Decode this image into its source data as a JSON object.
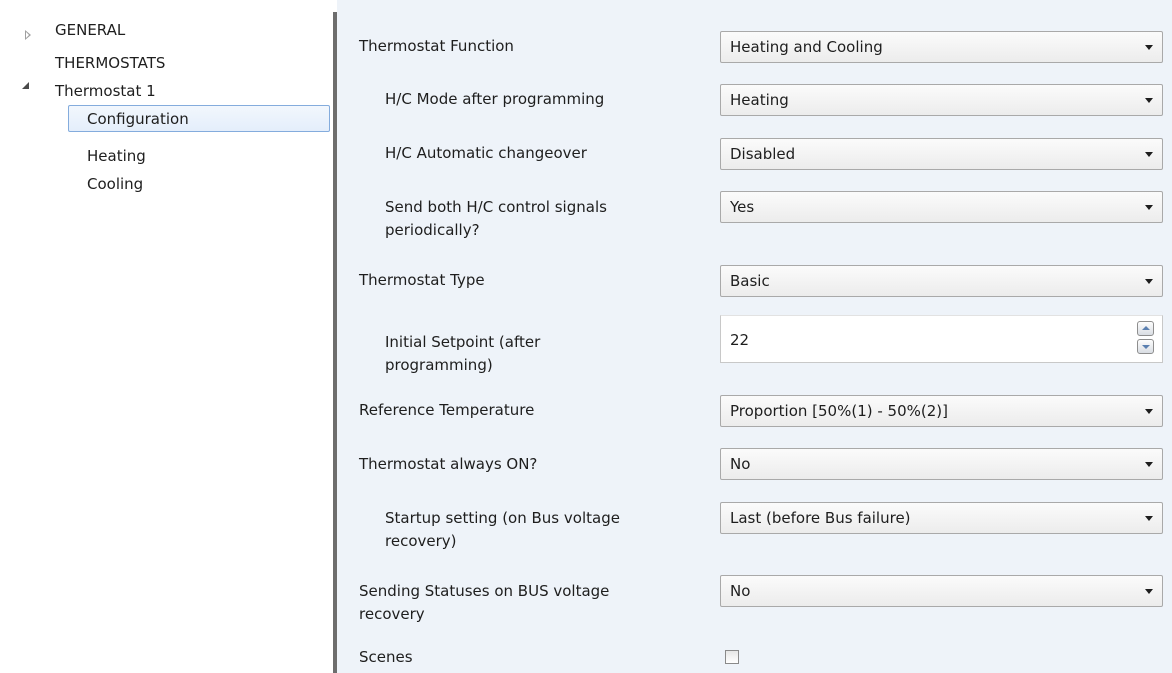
{
  "sidebar": {
    "items": [
      {
        "label": "GENERAL"
      },
      {
        "label": "THERMOSTATS"
      },
      {
        "label": "Thermostat 1"
      },
      {
        "label": "Configuration"
      },
      {
        "label": "Heating"
      },
      {
        "label": "Cooling"
      }
    ],
    "selected_color": "#84acdd"
  },
  "params": {
    "thermostat_function": {
      "label": "Thermostat Function",
      "value": "Heating and Cooling"
    },
    "hc_mode": {
      "label": "H/C Mode after programming",
      "value": "Heating"
    },
    "hc_auto": {
      "label": "H/C Automatic changeover",
      "value": "Disabled"
    },
    "send_both": {
      "label": "Send both H/C control signals periodically?",
      "value": "Yes"
    },
    "thermostat_type": {
      "label": "Thermostat Type",
      "value": "Basic"
    },
    "initial_setpoint": {
      "label": "Initial Setpoint (after programming)",
      "value": "22"
    },
    "reference_temp": {
      "label": "Reference Temperature",
      "value": "Proportion [50%(1) - 50%(2)]"
    },
    "always_on": {
      "label": "Thermostat always ON?",
      "value": "No"
    },
    "startup_setting": {
      "label": "Startup setting (on Bus voltage recovery)",
      "value": "Last (before Bus failure)"
    },
    "sending_statuses": {
      "label": "Sending Statuses on BUS voltage recovery",
      "value": "No"
    },
    "scenes": {
      "label": "Scenes",
      "checked": false
    }
  },
  "colors": {
    "panel_background": "#eef3f9",
    "splitter": "#6d6d6d"
  }
}
